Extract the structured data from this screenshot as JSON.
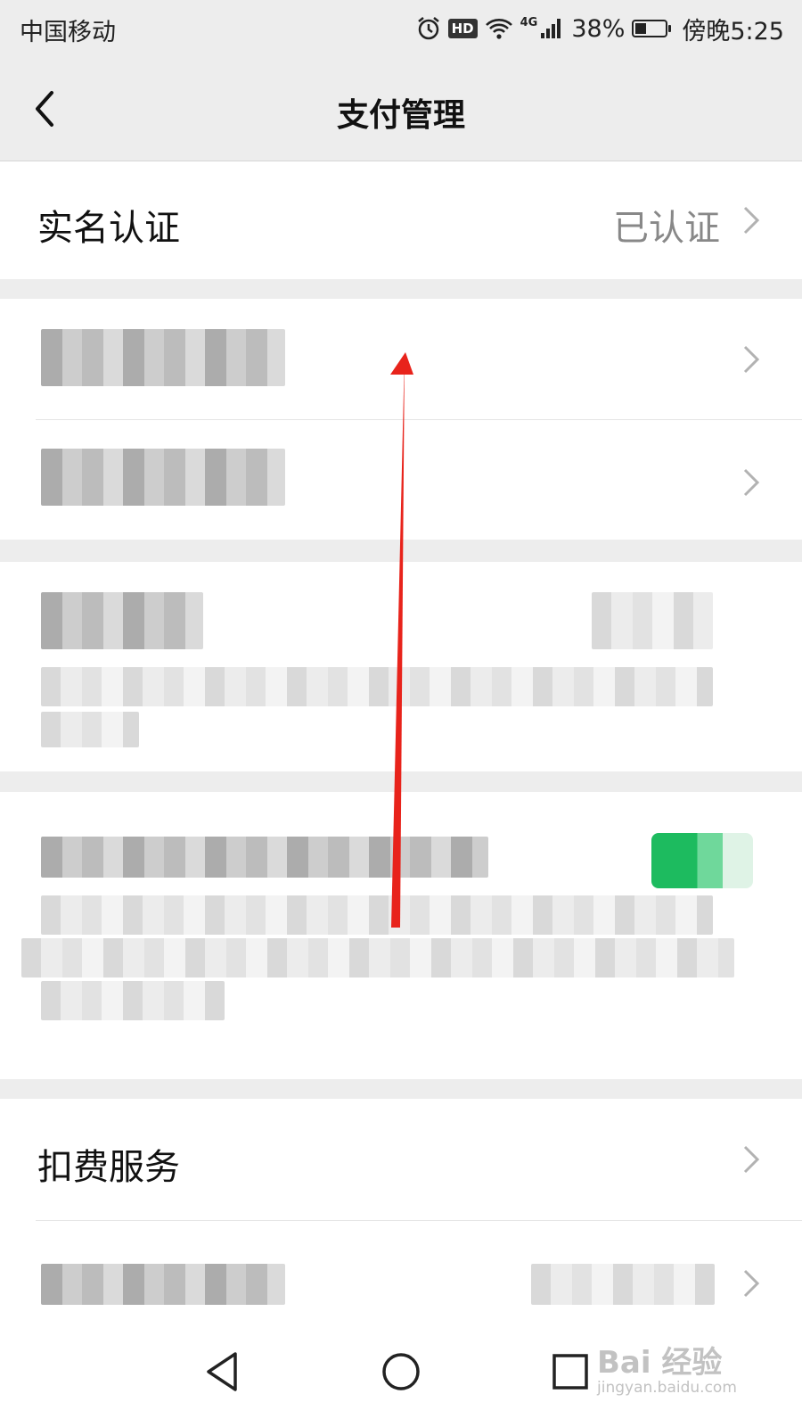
{
  "status_bar": {
    "carrier": "中国移动",
    "hd_badge": "HD",
    "network": "4G",
    "battery": "38%",
    "time": "傍晚5:25"
  },
  "nav": {
    "title": "支付管理"
  },
  "cells": {
    "real_name": {
      "label": "实名认证",
      "value": "已认证"
    },
    "deduction": {
      "label": "扣费服务"
    }
  },
  "watermark": {
    "brand": "Bai 经验",
    "sub": "jingyan.baidu.com"
  }
}
